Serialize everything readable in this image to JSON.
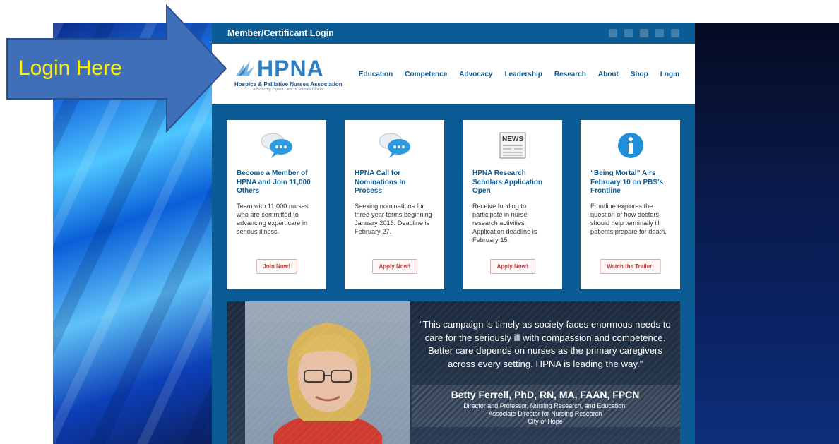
{
  "callout": {
    "text": "Login Here"
  },
  "site": {
    "topbar_title": "Member/Certificant Login",
    "logo": {
      "name": "HPNA",
      "subtitle": "Hospice & Palliative Nurses Association",
      "tagline": "Advancing Expert Care in Serious Illness"
    },
    "nav": [
      "Education",
      "Competence",
      "Advocacy",
      "Leadership",
      "Research",
      "About",
      "Shop",
      "Login"
    ],
    "social_icons": [
      "twitter-icon",
      "youtube-icon",
      "facebook-icon",
      "linkedin-icon",
      "instagram-icon"
    ],
    "cards": [
      {
        "icon": "chat-bubbles-icon",
        "title": "Become a Member of HPNA and Join 11,000 Others",
        "body": "Team with 11,000 nurses who are committed to advancing expert care in serious illness.",
        "button": "Join Now!"
      },
      {
        "icon": "chat-bubbles-icon",
        "title": "HPNA Call for Nominations In Process",
        "body": "Seeking nominations for three-year terms beginning January 2016. Deadline is February 27.",
        "button": "Apply Now!"
      },
      {
        "icon": "newspaper-icon",
        "icon_text": "NEWS",
        "title": "HPNA Research Scholars Application Open",
        "body": "Receive funding to participate in nurse research activities. Application deadline is February 15.",
        "button": "Apply Now!"
      },
      {
        "icon": "info-icon",
        "title": "“Being Mortal” Airs February 10 on PBS’s Frontline",
        "body": "Frontline explores the question of how doctors should help terminally ill patients prepare for death.",
        "button": "Watch the Trailer!"
      }
    ],
    "banner": {
      "quote": "“This campaign is timely as society faces enormous needs to care for the seriously ill with compassion and competence. Better care depends on nurses as the primary caregivers across every setting. HPNA is leading the way.”",
      "name": "Betty Ferrell, PhD, RN, MA, FAAN, FPCN",
      "title_line1": "Director and Professor, Nursing Research, and Education;",
      "title_line2": "Associate Director for Nursing Research",
      "title_line3": "City of Hope"
    }
  },
  "colors": {
    "brand_blue": "#0b5b94",
    "callout_fill": "#3e6fb8",
    "callout_text": "#fff200",
    "button_text": "#c64040"
  }
}
